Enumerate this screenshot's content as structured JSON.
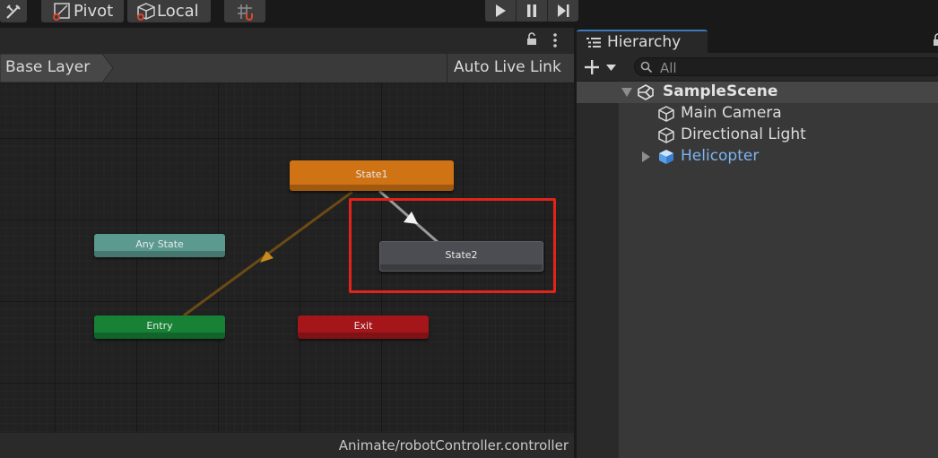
{
  "toolbar": {
    "pivot_label": "Pivot",
    "local_label": "Local"
  },
  "animator": {
    "breadcrumb": "Base Layer",
    "auto_live_link": "Auto Live Link",
    "status_path": "Animate/robotController.controller",
    "nodes": {
      "state1": "State1",
      "state2": "State2",
      "any_state": "Any State",
      "entry": "Entry",
      "exit": "Exit"
    },
    "colors": {
      "default_state": "#cf7315",
      "state": "#4c4d52",
      "any_state": "#5a9a8f",
      "entry": "#178236",
      "exit": "#a5161a",
      "highlight_box": "#e2231a"
    }
  },
  "hierarchy": {
    "tab_title": "Hierarchy",
    "search_placeholder": "All",
    "items": [
      {
        "label": "SampleScene",
        "icon": "unity-scene-icon"
      },
      {
        "label": "Main Camera",
        "icon": "gameobject-cube-icon"
      },
      {
        "label": "Directional Light",
        "icon": "gameobject-cube-icon"
      },
      {
        "label": "Helicopter",
        "icon": "prefab-cube-icon",
        "color": "#7db3f0"
      }
    ]
  }
}
